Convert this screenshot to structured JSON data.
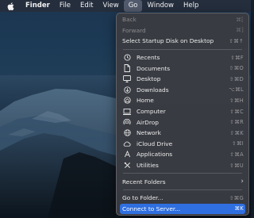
{
  "menubar": {
    "apple_icon": "apple-icon",
    "app_name": "Finder",
    "items": [
      "File",
      "Edit",
      "View",
      "Go",
      "Window",
      "Help"
    ],
    "active": "Go"
  },
  "go_menu": {
    "nav": [
      {
        "label": "Back",
        "shortcut": "⌘[",
        "enabled": false
      },
      {
        "label": "Forward",
        "shortcut": "⌘]",
        "enabled": false
      },
      {
        "label": "Select Startup Disk on Desktop",
        "shortcut": "⇧⌘↑",
        "enabled": true
      }
    ],
    "places": [
      {
        "label": "Recents",
        "shortcut": "⇧⌘F",
        "icon": "clock-icon"
      },
      {
        "label": "Documents",
        "shortcut": "⇧⌘O",
        "icon": "document-icon"
      },
      {
        "label": "Desktop",
        "shortcut": "⇧⌘D",
        "icon": "desktop-icon"
      },
      {
        "label": "Downloads",
        "shortcut": "⌥⌘L",
        "icon": "download-icon"
      },
      {
        "label": "Home",
        "shortcut": "⇧⌘H",
        "icon": "home-icon"
      },
      {
        "label": "Computer",
        "shortcut": "⇧⌘C",
        "icon": "computer-icon"
      },
      {
        "label": "AirDrop",
        "shortcut": "⇧⌘R",
        "icon": "airdrop-icon"
      },
      {
        "label": "Network",
        "shortcut": "⇧⌘K",
        "icon": "network-icon"
      },
      {
        "label": "iCloud Drive",
        "shortcut": "⇧⌘I",
        "icon": "icloud-icon"
      },
      {
        "label": "Applications",
        "shortcut": "⇧⌘A",
        "icon": "applications-icon"
      },
      {
        "label": "Utilities",
        "shortcut": "⇧⌘U",
        "icon": "utilities-icon"
      }
    ],
    "recent_folders": {
      "label": "Recent Folders",
      "icon": "chevron-right-icon"
    },
    "go_to_folder": {
      "label": "Go to Folder...",
      "shortcut": "⇧⌘G"
    },
    "connect_to_server": {
      "label": "Connect to Server...",
      "shortcut": "⌘K",
      "highlighted": true
    }
  },
  "colors": {
    "highlight": "#2f6fe0",
    "menu_bg": "#3a3c42",
    "menubar_bg": "#262e3c"
  }
}
